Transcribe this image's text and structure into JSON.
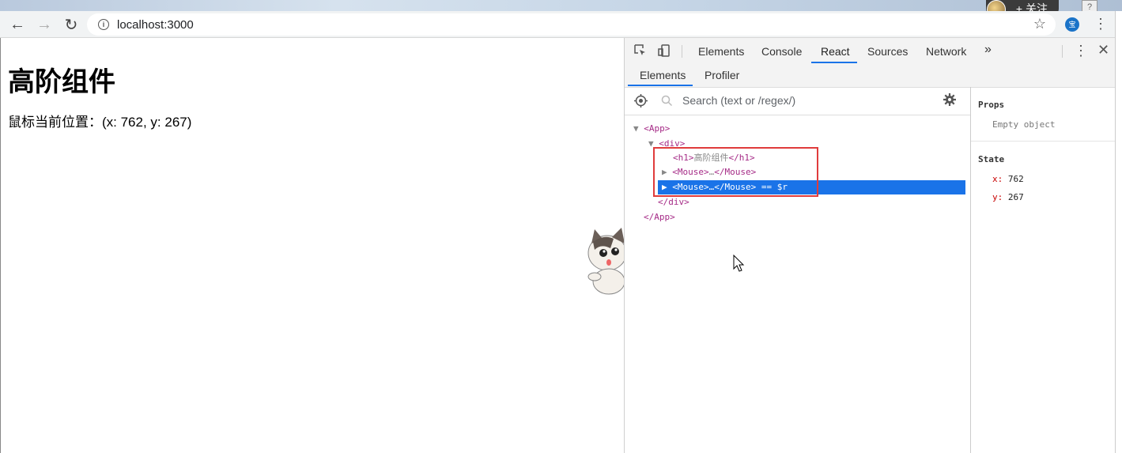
{
  "browser": {
    "url": "localhost:3000",
    "follow_label": "+ 关注",
    "profile_badge": "宝",
    "help_label": "?"
  },
  "page": {
    "title": "高阶组件",
    "position_text": "鼠标当前位置：(x: 762, y: 267)"
  },
  "devtools": {
    "tabs": [
      "Elements",
      "Console",
      "React",
      "Sources",
      "Network"
    ],
    "active_tab": "React",
    "more_label": "»",
    "subtabs": [
      "Elements",
      "Profiler"
    ],
    "search_placeholder": "Search (text or /regex/)",
    "tree": {
      "app_open": "<App>",
      "div_open": "<div>",
      "h1_open": "<h1>",
      "h1_text": "高阶组件",
      "h1_close": "</h1>",
      "mouse1_open": "<Mouse>",
      "mouse1_ellipsis": "…",
      "mouse1_close": "</Mouse>",
      "mouse2_open": "<Mouse>",
      "mouse2_ellipsis": "…",
      "mouse2_close": "</Mouse>",
      "mouse2_suffix": " == $r",
      "div_close": "</div>",
      "app_close": "</App>"
    },
    "props_header": "Props",
    "props_empty": "Empty object",
    "state_header": "State",
    "state": [
      {
        "key": "x",
        "sep": ": ",
        "value": "762"
      },
      {
        "key": "y",
        "sep": ": ",
        "value": "267"
      }
    ]
  }
}
